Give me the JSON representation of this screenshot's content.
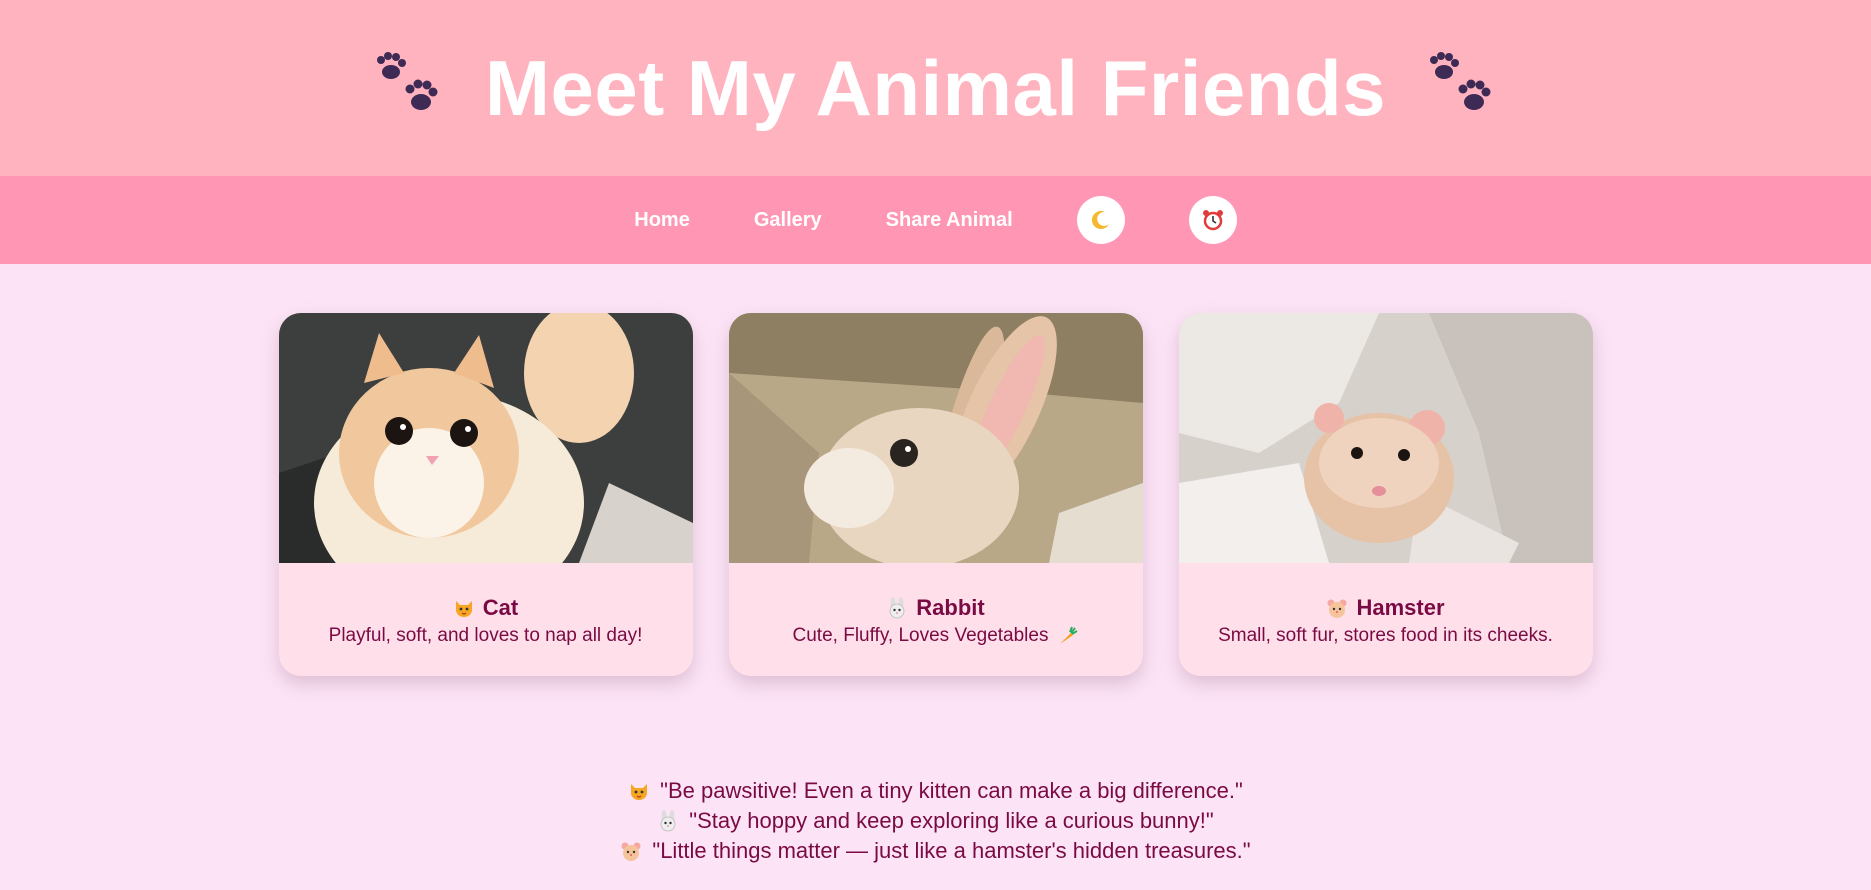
{
  "header": {
    "title": "Meet My Animal Friends",
    "left_icon": "paw-prints-icon",
    "right_icon": "paw-prints-icon"
  },
  "nav": {
    "links": [
      "Home",
      "Gallery",
      "Share Animal"
    ],
    "theme_toggle_icon": "moon-icon",
    "alarm_icon": "alarm-clock-icon"
  },
  "cards": [
    {
      "icon": "cat-face-icon",
      "name": "Cat",
      "description": "Playful, soft, and loves to nap all day!"
    },
    {
      "icon": "rabbit-face-icon",
      "name": "Rabbit",
      "description": "Cute, Fluffy, Loves Vegetables",
      "desc_icon": "carrot-icon"
    },
    {
      "icon": "hamster-face-icon",
      "name": "Hamster",
      "description": "Small, soft fur, stores food in its cheeks."
    }
  ],
  "quotes": [
    {
      "icon": "cat-face-icon",
      "text": "\"Be pawsitive! Even a tiny kitten can make a big difference.\""
    },
    {
      "icon": "rabbit-face-icon",
      "text": "\"Stay hoppy and keep exploring like a curious bunny!\""
    },
    {
      "icon": "hamster-face-icon",
      "text": "\"Little things matter — just like a hamster's hidden treasures.\""
    }
  ],
  "colors": {
    "header_bg": "#ffb3be",
    "nav_bg": "#ff97b4",
    "page_bg": "#fce4f6",
    "card_bg": "#ffe0ea",
    "text_accent": "#7a0a44"
  }
}
